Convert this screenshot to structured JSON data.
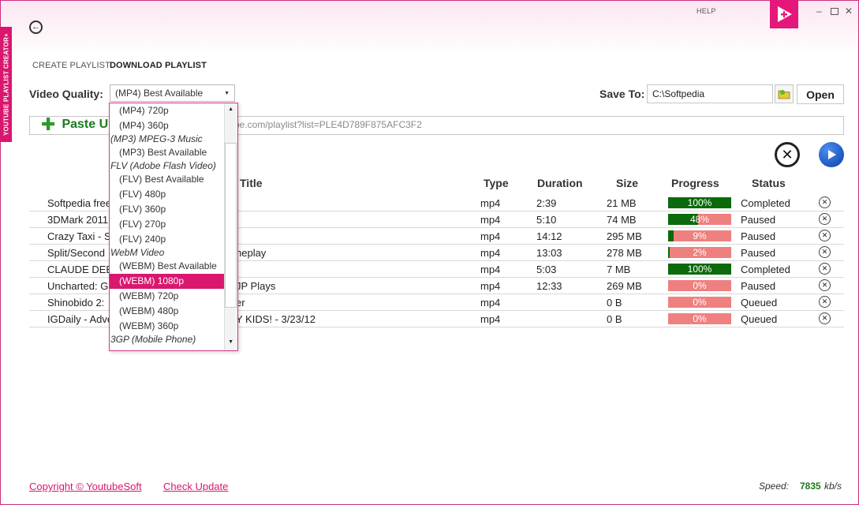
{
  "app": {
    "side_title": "YOUTUBE PLAYLIST CREATOR+",
    "help": "HELP",
    "accent": "#e5177a"
  },
  "tabs": {
    "create": "CREATE PLAYLIST",
    "download": "DOWNLOAD PLAYLIST"
  },
  "quality": {
    "label": "Video Quality:",
    "selected": "(MP4) Best Available",
    "options": [
      {
        "text": "(MP4) 720p",
        "kind": "option"
      },
      {
        "text": "(MP4) 360p",
        "kind": "option"
      },
      {
        "text": "(MP3) MPEG-3 Music",
        "kind": "group"
      },
      {
        "text": "(MP3) Best Available",
        "kind": "option"
      },
      {
        "text": "FLV (Adobe Flash Video)",
        "kind": "group"
      },
      {
        "text": "(FLV) Best Available",
        "kind": "option"
      },
      {
        "text": "(FLV) 480p",
        "kind": "option"
      },
      {
        "text": "(FLV) 360p",
        "kind": "option"
      },
      {
        "text": "(FLV) 270p",
        "kind": "option"
      },
      {
        "text": "(FLV) 240p",
        "kind": "option"
      },
      {
        "text": "WebM Video",
        "kind": "group"
      },
      {
        "text": "(WEBM) Best Available",
        "kind": "option"
      },
      {
        "text": "(WEBM) 1080p",
        "kind": "option",
        "selected": true
      },
      {
        "text": "(WEBM) 720p",
        "kind": "option"
      },
      {
        "text": "(WEBM) 480p",
        "kind": "option"
      },
      {
        "text": "(WEBM) 360p",
        "kind": "option"
      },
      {
        "text": "3GP (Mobile Phone)",
        "kind": "group"
      }
    ]
  },
  "save": {
    "label": "Save To:",
    "path": "C:\\Softpedia",
    "open": "Open"
  },
  "paste": {
    "label": "Paste U",
    "url_visible": "be.com/playlist?list=PLE4D789F875AFC3F2"
  },
  "columns": {
    "title": "Title",
    "type": "Type",
    "duration": "Duration",
    "size": "Size",
    "progress": "Progress",
    "status": "Status"
  },
  "rows": [
    {
      "title": "Softpedia free",
      "title_rest": "",
      "type": "mp4",
      "duration": "2:39",
      "size": "21 MB",
      "progress": 100,
      "progress_label": "100%",
      "status": "Completed"
    },
    {
      "title": "3DMark 2011",
      "title_rest": "",
      "type": "mp4",
      "duration": "5:10",
      "size": "74 MB",
      "progress": 48,
      "progress_label": "48%",
      "status": "Paused"
    },
    {
      "title": "Crazy Taxi - S",
      "title_rest": "",
      "type": "mp4",
      "duration": "14:12",
      "size": "295 MB",
      "progress": 9,
      "progress_label": "9%",
      "status": "Paused"
    },
    {
      "title": "Split/Second",
      "title_rest": "neplay",
      "type": "mp4",
      "duration": "13:03",
      "size": "278 MB",
      "progress": 2,
      "progress_label": "2%",
      "status": "Paused"
    },
    {
      "title": "CLAUDE DEBU",
      "title_rest": "",
      "type": "mp4",
      "duration": "5:03",
      "size": "7 MB",
      "progress": 100,
      "progress_label": "100%",
      "status": "Completed"
    },
    {
      "title": "Uncharted: Go",
      "title_rest": "JP Plays",
      "type": "mp4",
      "duration": "12:33",
      "size": "269 MB",
      "progress": 0,
      "progress_label": "0%",
      "status": "Paused"
    },
    {
      "title": "Shinobido 2:",
      "title_rest": "er",
      "type": "mp4",
      "duration": "",
      "size": "0 B",
      "progress": 0,
      "progress_label": "0%",
      "status": "Queued"
    },
    {
      "title": "IGDaily - Adve",
      "title_rest": "Y KIDS! - 3/23/12",
      "type": "mp4",
      "duration": "",
      "size": "0 B",
      "progress": 0,
      "progress_label": "0%",
      "status": "Queued"
    }
  ],
  "footer": {
    "copyright": "Copyright © YoutubeSoft",
    "check_update": "Check Update",
    "speed_label": "Speed:",
    "speed_value": "7835",
    "speed_unit": "kb/s"
  },
  "colors": {
    "progress_done": "#0b6a0b",
    "progress_remaining": "#ef8080",
    "link": "#d9176f"
  }
}
